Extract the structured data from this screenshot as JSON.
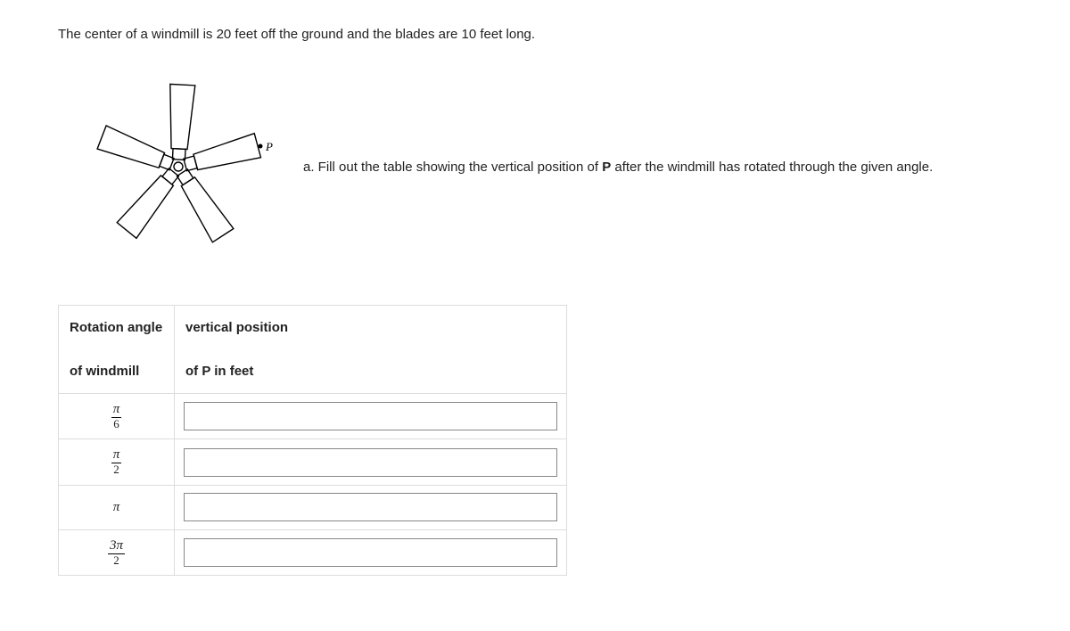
{
  "intro": "The center of a windmill is 20 feet off the ground and the blades are 10 feet long.",
  "point_label": "P",
  "question_a_prefix": "a. Fill out the table showing the vertical position of ",
  "question_a_bold": "P",
  "question_a_suffix": " after the windmill has rotated through the given angle.",
  "table": {
    "header_col1_line1": "Rotation angle",
    "header_col1_line2": "of windmill",
    "header_col2_line1": "vertical position",
    "header_col2_line2": "of P in feet",
    "rows": [
      {
        "angle_num": "π",
        "angle_den": "6",
        "is_fraction": true,
        "value": ""
      },
      {
        "angle_num": "π",
        "angle_den": "2",
        "is_fraction": true,
        "value": ""
      },
      {
        "angle_plain": "π",
        "is_fraction": false,
        "value": ""
      },
      {
        "angle_num": "3π",
        "angle_den": "2",
        "is_fraction": true,
        "value": ""
      }
    ]
  }
}
